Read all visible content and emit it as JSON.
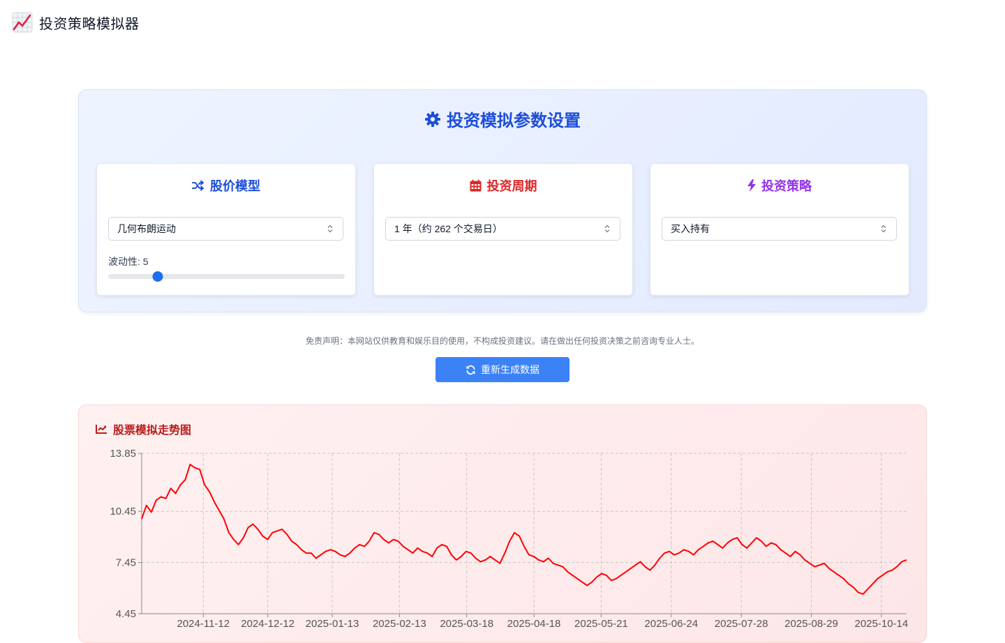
{
  "header": {
    "logo_icon": "chart-increasing-icon",
    "title": "投资策略模拟器"
  },
  "settings": {
    "title": "投资模拟参数设置",
    "title_icon": "gear-icon",
    "accent": "#1d4ed8",
    "cards": [
      {
        "title": "股价模型",
        "icon": "shuffle-icon",
        "color": "#1d4ed8",
        "select_value": "几何布朗运动"
      },
      {
        "title": "投资周期",
        "icon": "calendar-icon",
        "color": "#dc2626",
        "select_value": "1 年（约 262 个交易日）"
      },
      {
        "title": "投资策略",
        "icon": "bolt-icon",
        "color": "#9333ea",
        "select_value": "买入持有"
      }
    ],
    "volatility": {
      "label": "波动性: 5",
      "value": 5,
      "min": 1,
      "max": 20
    }
  },
  "disclaimer": "免责声明：本网站仅供教育和娱乐目的使用，不构成投资建议。请在做出任何投资决策之前咨询专业人士。",
  "regen_button": {
    "label": "重新生成数据",
    "icon": "refresh-icon",
    "color": "#3b82f6"
  },
  "chart": {
    "title": "股票模拟走势图",
    "title_icon": "line-chart-icon",
    "color": "#b91c1c"
  },
  "chart_data": {
    "type": "line",
    "title": "",
    "line_color": "#ff0000",
    "y_ticks": [
      13.85,
      10.45,
      7.45,
      4.45
    ],
    "ylim": [
      4.45,
      13.85
    ],
    "x_tick_labels": [
      "2024-11-12",
      "2024-12-12",
      "2025-01-13",
      "2025-02-13",
      "2025-03-18",
      "2025-04-18",
      "2025-05-21",
      "2025-06-24",
      "2025-07-28",
      "2025-08-29",
      "2025-10-14"
    ],
    "x_tick_index": [
      22,
      45,
      68,
      92,
      116,
      140,
      164,
      189,
      214,
      239,
      264
    ],
    "x_range": [
      0,
      273
    ],
    "grid": true,
    "series": [
      {
        "values": [
          10.0,
          10.8,
          10.4,
          11.1,
          11.3,
          11.2,
          11.8,
          11.5,
          12.0,
          12.3,
          13.2,
          13.0,
          12.9,
          12.0,
          11.6,
          11.0,
          10.5,
          10.0,
          9.2,
          8.8,
          8.5,
          8.9,
          9.5,
          9.7,
          9.4,
          9.0,
          8.8,
          9.2,
          9.3,
          9.4,
          9.1,
          8.7,
          8.5,
          8.2,
          8.0,
          8.0,
          7.7,
          7.9,
          8.1,
          8.2,
          8.1,
          7.9,
          7.8,
          8.0,
          8.3,
          8.5,
          8.4,
          8.7,
          9.2,
          9.1,
          8.8,
          8.6,
          8.8,
          8.7,
          8.4,
          8.2,
          8.0,
          8.3,
          8.1,
          8.0,
          7.8,
          8.3,
          8.5,
          8.4,
          7.9,
          7.6,
          7.8,
          8.1,
          8.0,
          7.7,
          7.5,
          7.6,
          7.8,
          7.6,
          7.4,
          8.0,
          8.7,
          9.2,
          9.0,
          8.4,
          7.9,
          7.8,
          7.6,
          7.5,
          7.7,
          7.4,
          7.3,
          7.2,
          6.9,
          6.7,
          6.5,
          6.3,
          6.1,
          6.3,
          6.6,
          6.8,
          6.7,
          6.4,
          6.5,
          6.7,
          6.9,
          7.1,
          7.3,
          7.5,
          7.2,
          7.0,
          7.3,
          7.7,
          8.0,
          8.1,
          7.9,
          8.0,
          8.2,
          8.1,
          7.9,
          8.2,
          8.4,
          8.6,
          8.7,
          8.5,
          8.3,
          8.6,
          8.8,
          8.9,
          8.5,
          8.3,
          8.6,
          8.9,
          8.7,
          8.4,
          8.6,
          8.5,
          8.2,
          8.0,
          7.8,
          8.1,
          7.9,
          7.6,
          7.4,
          7.2,
          7.3,
          7.4,
          7.1,
          6.9,
          6.7,
          6.5,
          6.2,
          6.0,
          5.7,
          5.6,
          5.9,
          6.2,
          6.5,
          6.7,
          6.9,
          7.0,
          7.2,
          7.5,
          7.6
        ]
      }
    ]
  }
}
